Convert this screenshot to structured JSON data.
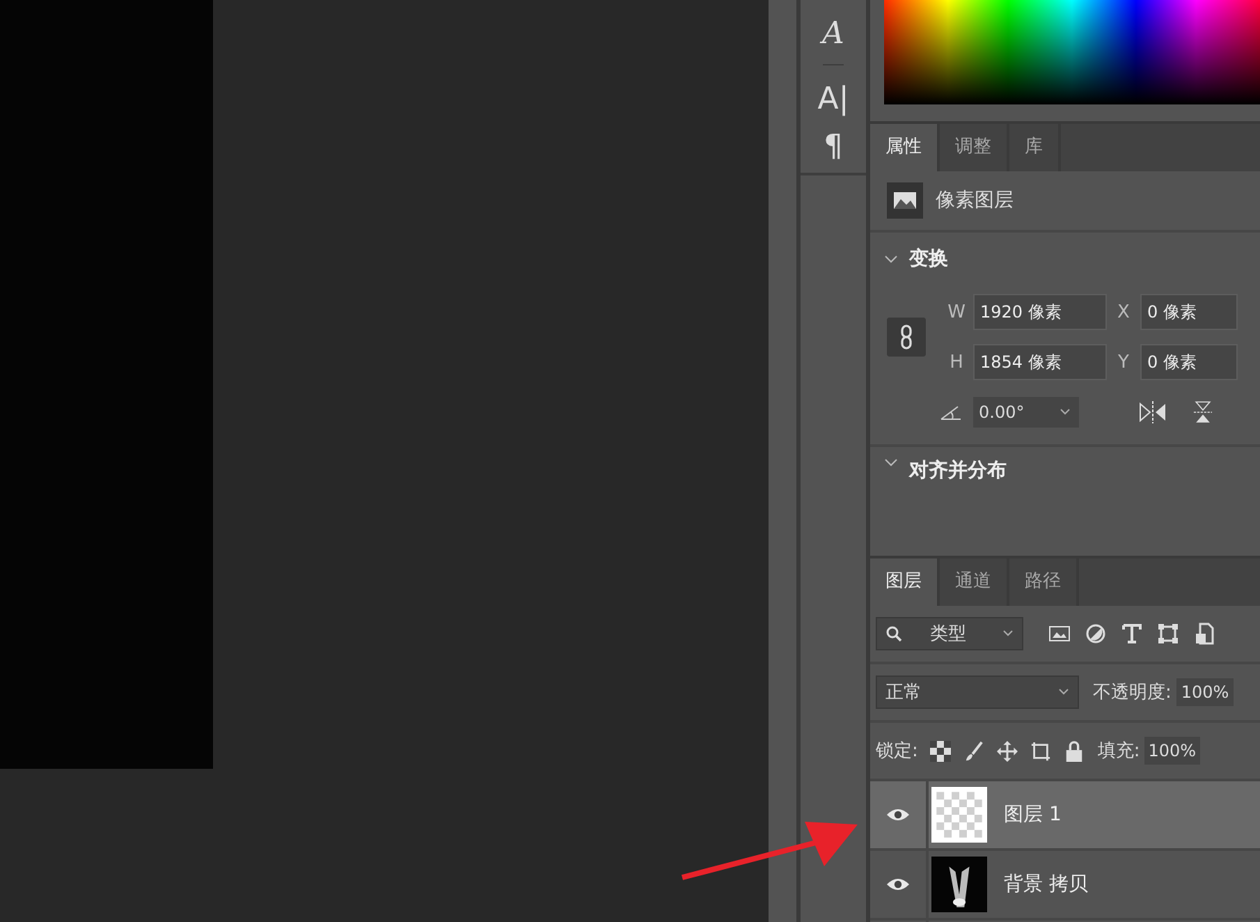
{
  "tools": [
    {
      "glyph": "A",
      "italic": true
    },
    {
      "glyph": "A|",
      "italic": false
    },
    {
      "glyph": "¶",
      "italic": false
    }
  ],
  "properties": {
    "tabs": [
      {
        "label": "属性",
        "selected": true
      },
      {
        "label": "调整",
        "selected": false
      },
      {
        "label": "库",
        "selected": false
      }
    ],
    "layer_type": "像素图层",
    "transform": {
      "title": "变换",
      "fields": [
        {
          "label": "W",
          "value": "1920 像素"
        },
        {
          "label": "X",
          "value": "0 像素"
        },
        {
          "label": "H",
          "value": "1854 像素"
        },
        {
          "label": "Y",
          "value": "0 像素"
        }
      ],
      "angle": "0.00°"
    },
    "align": {
      "title": "对齐并分布"
    }
  },
  "layers_panel": {
    "tabs": [
      {
        "label": "图层",
        "selected": true
      },
      {
        "label": "通道",
        "selected": false
      },
      {
        "label": "路径",
        "selected": false
      }
    ],
    "filter": "类型",
    "blend_mode": "正常",
    "opacity_label": "不透明度:",
    "opacity": "100%",
    "lock_label": "锁定:",
    "fill_label": "填充:",
    "fill": "100%",
    "layers": [
      {
        "name": "图层 1",
        "visible": true,
        "selected": true,
        "kind": "transparent"
      },
      {
        "name": "背景 拷贝",
        "visible": true,
        "selected": false,
        "kind": "image"
      }
    ]
  }
}
